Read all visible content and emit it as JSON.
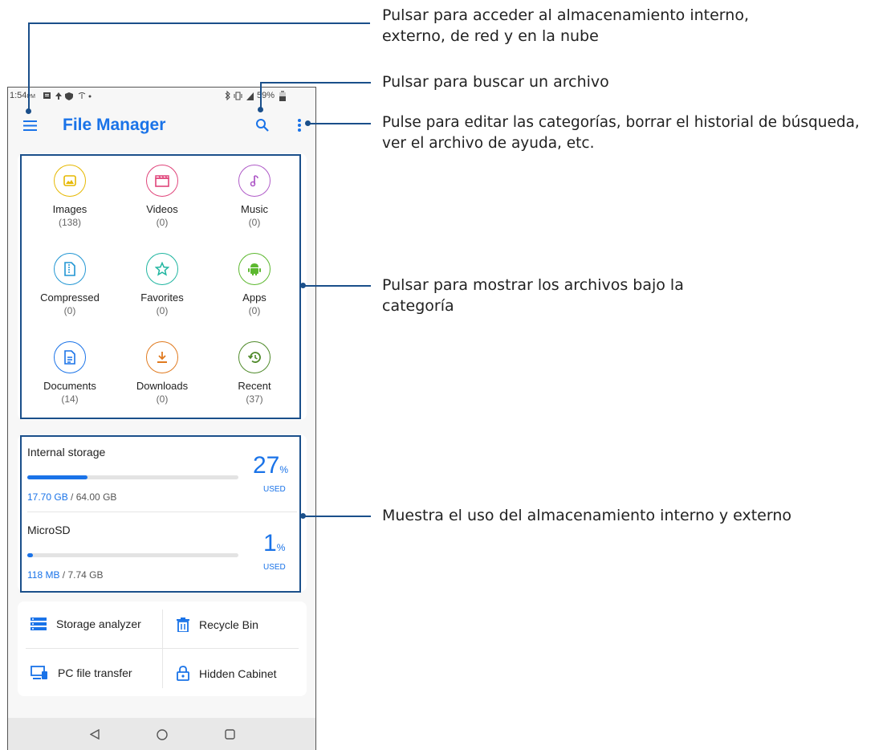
{
  "status": {
    "time": "1:54",
    "ampm": "PM",
    "battery": "59%"
  },
  "appbar": {
    "title": "File Manager"
  },
  "categories": [
    {
      "label": "Images",
      "count": "(138)",
      "color": "#e6b800",
      "icon": "image-icon"
    },
    {
      "label": "Videos",
      "count": "(0)",
      "color": "#e0457b",
      "icon": "clapperboard-icon"
    },
    {
      "label": "Music",
      "count": "(0)",
      "color": "#b05cc8",
      "icon": "music-note-icon"
    },
    {
      "label": "Compressed",
      "count": "(0)",
      "color": "#2196d3",
      "icon": "zip-file-icon"
    },
    {
      "label": "Favorites",
      "count": "(0)",
      "color": "#1fb5a0",
      "icon": "star-icon"
    },
    {
      "label": "Apps",
      "count": "(0)",
      "color": "#5cb82f",
      "icon": "android-icon"
    },
    {
      "label": "Documents",
      "count": "(14)",
      "color": "#1a73e8",
      "icon": "document-icon"
    },
    {
      "label": "Downloads",
      "count": "(0)",
      "color": "#e07a1f",
      "icon": "download-icon"
    },
    {
      "label": "Recent",
      "count": "(37)",
      "color": "#4f8a2a",
      "icon": "history-icon"
    }
  ],
  "storage": {
    "internal": {
      "label": "Internal storage",
      "used": "17.70 GB",
      "total": " / 64.00 GB",
      "percent": "27",
      "pct_unit": "%",
      "used_label": "USED",
      "fill_fraction": 0.27
    },
    "microsd": {
      "label": "MicroSD",
      "used": "118 MB",
      "total": " / 7.74 GB",
      "percent": "1",
      "pct_unit": "%",
      "used_label": "USED",
      "fill_fraction": 0.01
    }
  },
  "tools": {
    "storage_analyzer": "Storage analyzer",
    "recycle_bin": "Recycle Bin",
    "pc_transfer": "PC file transfer",
    "hidden_cabinet": "Hidden Cabinet"
  },
  "callouts": {
    "drawer_1": "Pulsar para acceder al almacenamiento interno,",
    "drawer_2": "externo, de red y en la nube",
    "search": "Pulsar para buscar un archivo",
    "menu_1": "Pulse para editar las categorías, borrar el historial de búsqueda,",
    "menu_2": "ver el archivo de ayuda, etc.",
    "category_1": "Pulsar para mostrar los archivos bajo la",
    "category_2": "categoría",
    "storage": "Muestra el uso del almacenamiento interno y externo"
  },
  "colors": {
    "accent": "#1a73e8",
    "callout_line": "#1a4f8a"
  }
}
